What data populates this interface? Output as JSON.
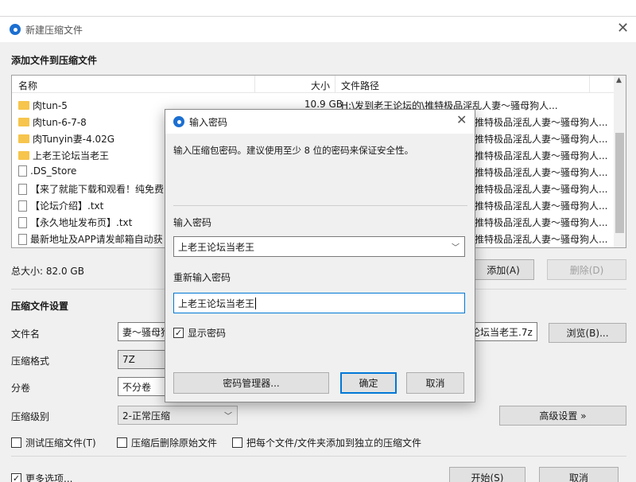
{
  "window": {
    "title": "新建压缩文件",
    "close": "✕",
    "add_section_title": "添加文件到压缩文件",
    "list": {
      "headers": {
        "name": "名称",
        "size": "大小",
        "path": "文件路径"
      },
      "rows": [
        {
          "name": "肉tun-5",
          "type": "folder",
          "size": "10.9 GB",
          "path": "H:\\发到老王论坛的\\推特极品淫乱人妻～骚母狗人..."
        },
        {
          "name": "肉tun-6-7-8",
          "type": "folder",
          "size": "",
          "path": "推特极品淫乱人妻～骚母狗人..."
        },
        {
          "name": "肉Tunyin妻-4.02G",
          "type": "folder",
          "size": "",
          "path": "推特极品淫乱人妻～骚母狗人..."
        },
        {
          "name": "上老王论坛当老王",
          "type": "folder",
          "size": "",
          "path": "推特极品淫乱人妻～骚母狗人..."
        },
        {
          "name": ".DS_Store",
          "type": "file",
          "size": "",
          "path": "推特极品淫乱人妻～骚母狗人..."
        },
        {
          "name": "【来了就能下载和观看！纯免费",
          "type": "file",
          "size": "",
          "path": "推特极品淫乱人妻～骚母狗人..."
        },
        {
          "name": "【论坛介绍】.txt",
          "type": "file",
          "size": "",
          "path": "推特极品淫乱人妻～骚母狗人..."
        },
        {
          "name": "【永久地址发布页】.txt",
          "type": "file",
          "size": "",
          "path": "推特极品淫乱人妻～骚母狗人..."
        },
        {
          "name": "最新地址及APP请发邮箱自动获",
          "type": "file",
          "size": "",
          "path": "推特极品淫乱人妻～骚母狗人..."
        }
      ]
    },
    "total_size": "总大小: 82.0 GB",
    "add_button": "添加(A)",
    "delete_button": "删除(D)",
    "settings_title": "压缩文件设置",
    "filename_label": "文件名",
    "filename_value_left": "妻～骚母狗",
    "filename_value_right": "论坛当老王.7z",
    "browse_button": "浏览(B)...",
    "format_label": "压缩格式",
    "format_value": "7Z",
    "split_label": "分卷",
    "split_value": "不分卷",
    "level_label": "压缩级别",
    "level_value": "2-正常压缩",
    "advanced_button": "高级设置 »",
    "test_checkbox": "测试压缩文件(T)",
    "delete_after_checkbox": "压缩后删除原始文件",
    "separate_checkbox": "把每个文件/文件夹添加到独立的压缩文件",
    "more_options": "更多选项...",
    "start_button": "开始(S)",
    "cancel_button": "取消"
  },
  "dialog": {
    "title": "输入密码",
    "close": "✕",
    "description": "输入压缩包密码。建议使用至少 8 位的密码来保证安全性。",
    "password_label": "输入密码",
    "password_value": "上老王论坛当老王",
    "confirm_label": "重新输入密码",
    "confirm_value": "上老王论坛当老王",
    "show_password": "显示密码",
    "manager_button": "密码管理器...",
    "ok_button": "确定",
    "cancel_button": "取消"
  }
}
